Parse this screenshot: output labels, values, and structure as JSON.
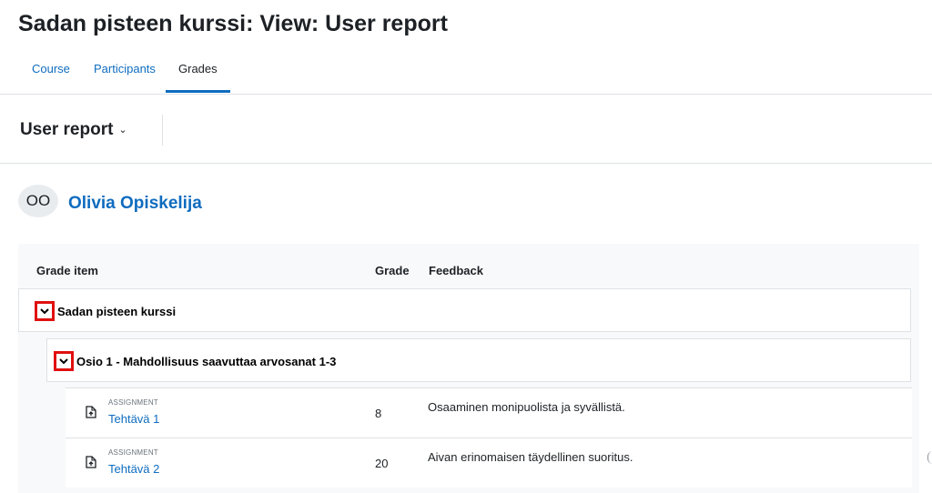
{
  "page": {
    "title": "Sadan pisteen kurssi: View: User report"
  },
  "nav": {
    "tabs": [
      {
        "label": "Course",
        "active": false
      },
      {
        "label": "Participants",
        "active": false
      },
      {
        "label": "Grades",
        "active": true
      }
    ]
  },
  "report": {
    "selector_label": "User report",
    "selector_icon": "chevron-down-icon"
  },
  "user": {
    "initials": "OO",
    "name": "Olivia Opiskelija"
  },
  "table": {
    "headers": {
      "item": "Grade item",
      "grade": "Grade",
      "feedback": "Feedback"
    },
    "course_category": {
      "label": "Sadan pisteen kurssi",
      "toggle_icon": "chevron-down-icon"
    },
    "section_category": {
      "label": "Osio 1 - Mahdollisuus saavuttaa arvosanat 1-3",
      "toggle_icon": "chevron-down-icon"
    },
    "items": [
      {
        "type": "ASSIGNMENT",
        "name": "Tehtävä 1",
        "grade": "8",
        "feedback": "Osaaminen monipuolista ja syvällistä.",
        "icon": "assignment-upload-icon"
      },
      {
        "type": "ASSIGNMENT",
        "name": "Tehtävä 2",
        "grade": "20",
        "feedback": "Aivan erinomaisen täydellinen suoritus.",
        "icon": "assignment-upload-icon"
      }
    ]
  },
  "colors": {
    "link": "#0f6cbf",
    "highlight_border": "#e01010",
    "table_bg": "#f8f9fa"
  }
}
